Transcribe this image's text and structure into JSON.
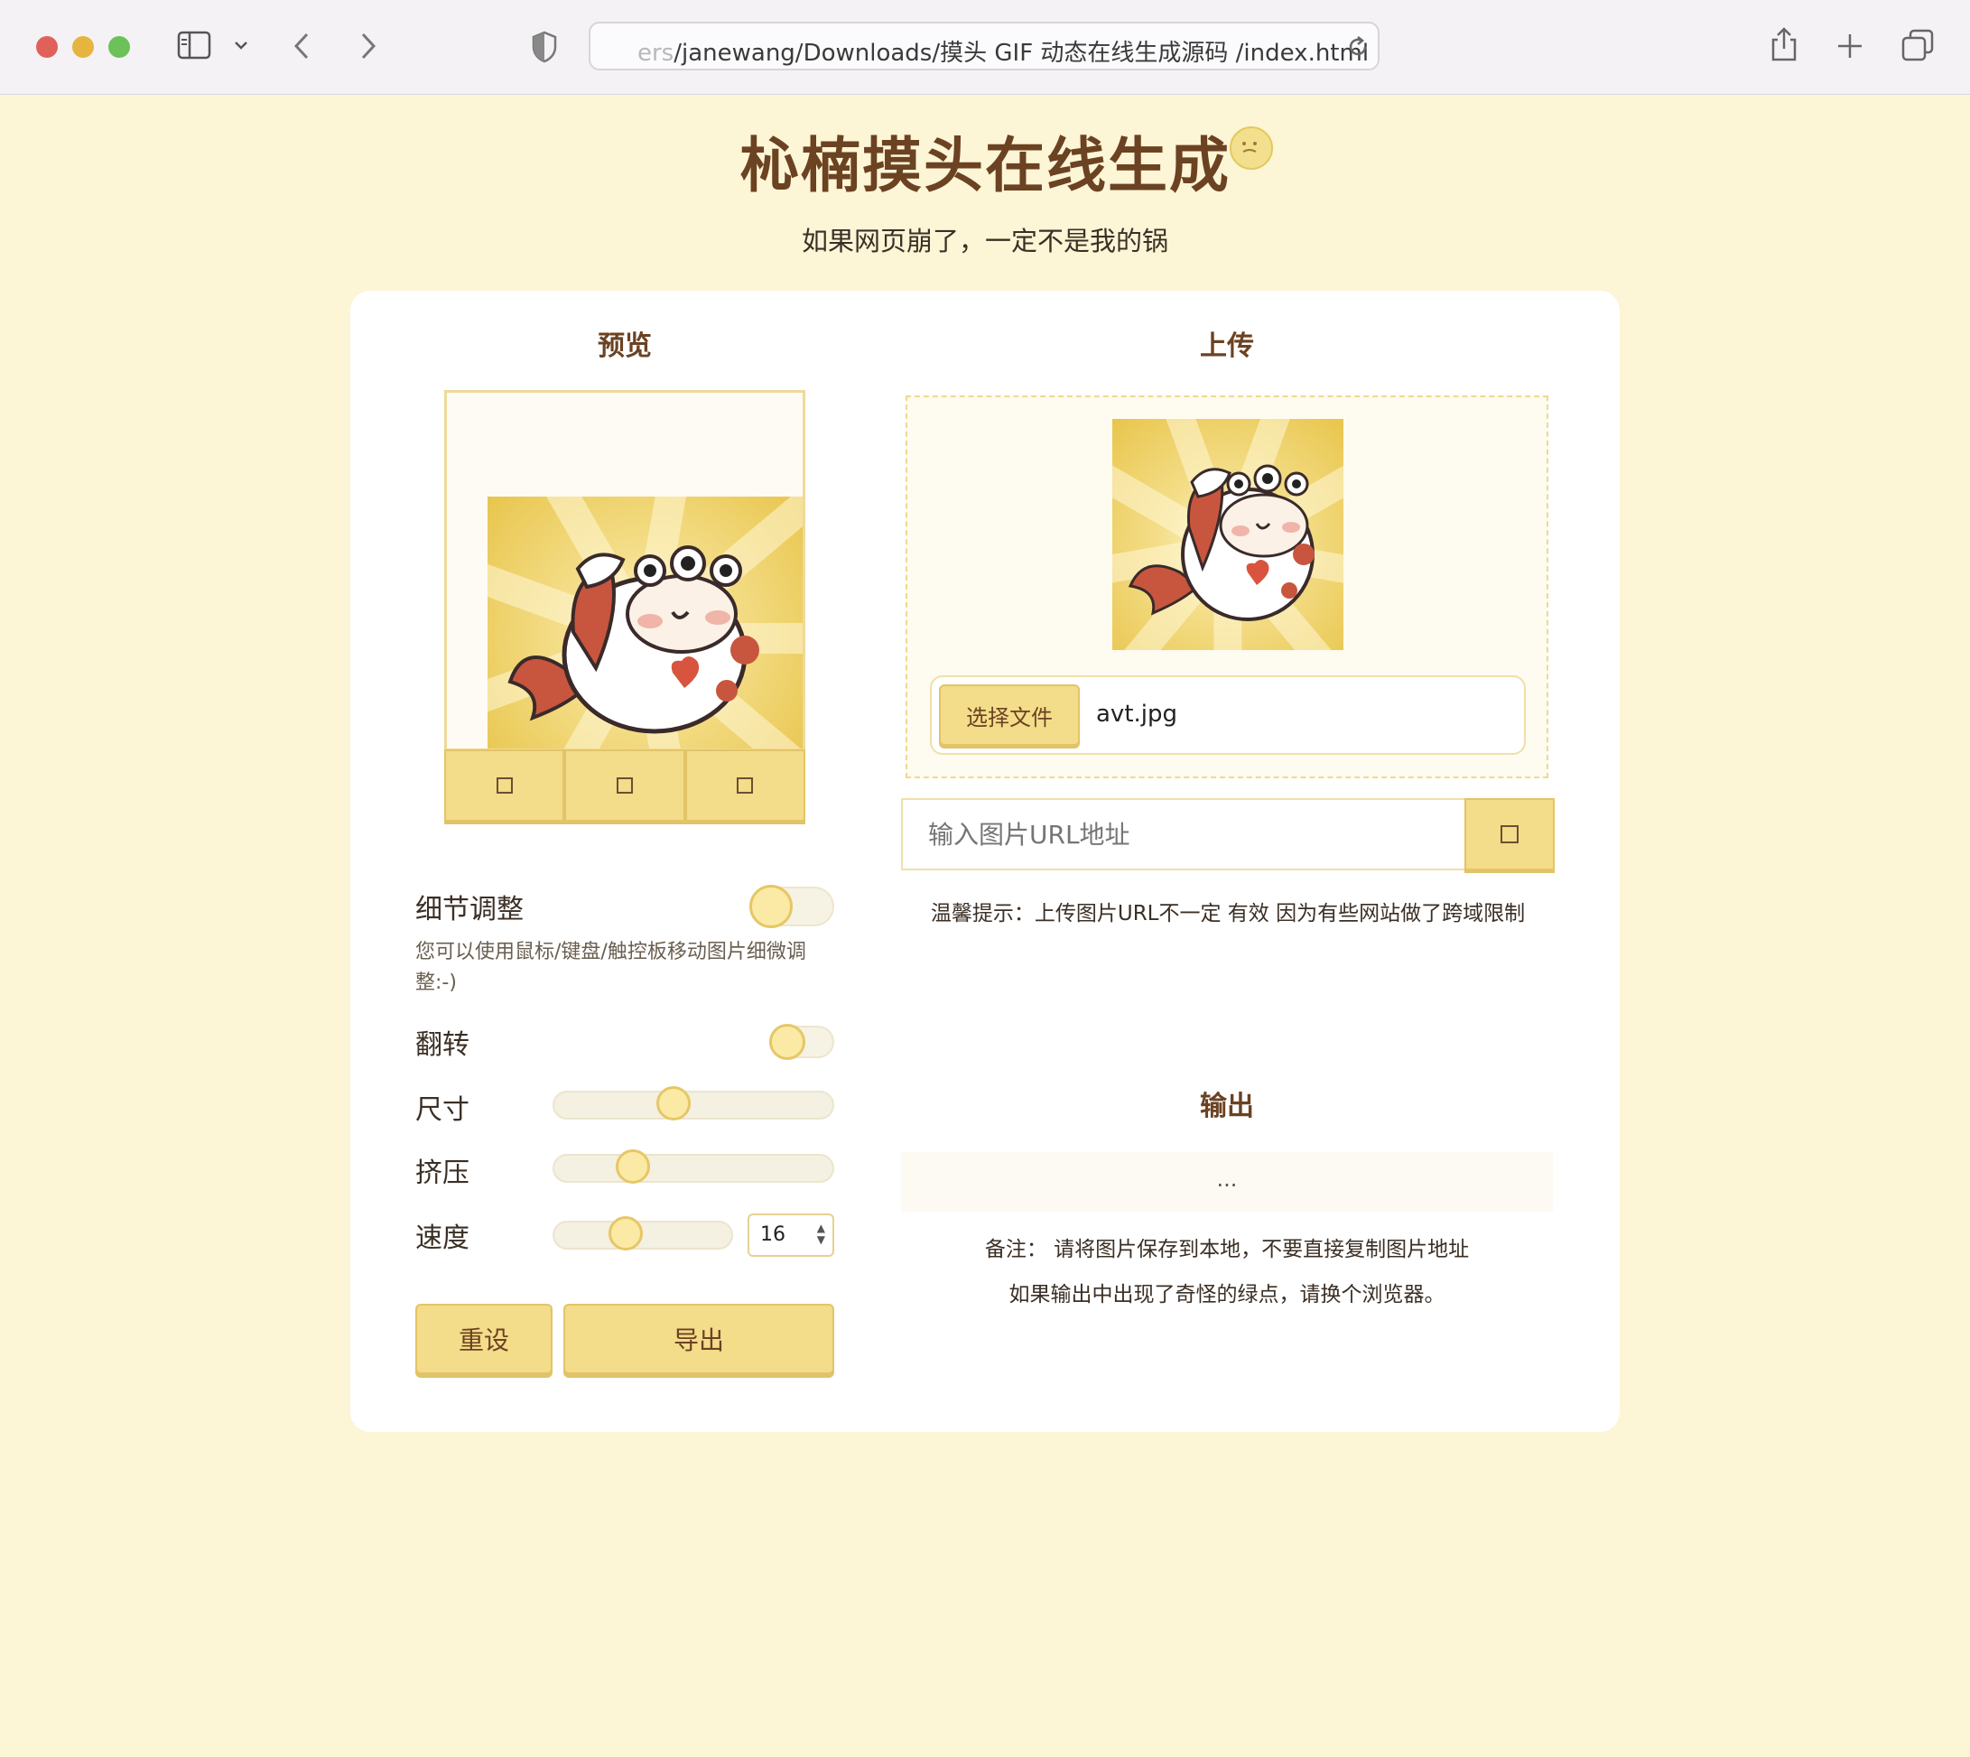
{
  "browser": {
    "url_fade": "ers",
    "url": "/janewang/Downloads/摸头 GIF 动态在线生成源码 /index.html"
  },
  "page": {
    "title": "杺楠摸头在线生成",
    "subtitle": "如果网页崩了，一定不是我的锅"
  },
  "preview": {
    "heading": "预览",
    "buttons": [
      "□",
      "□",
      "□"
    ]
  },
  "controls": {
    "detail_label": "细节调整",
    "detail_hint": "您可以使用鼠标/键盘/触控板移动图片细微调整:-)",
    "flip_label": "翻转",
    "size_label": "尺寸",
    "size_value": 0.42,
    "squeeze_label": "挤压",
    "squeeze_value": 0.25,
    "speed_label": "速度",
    "speed_value": 0.38,
    "speed_number": "16",
    "reset_label": "重设",
    "export_label": "导出"
  },
  "upload": {
    "heading": "上传",
    "file_button": "选择文件",
    "file_name": "avt.jpg",
    "url_placeholder": "输入图片URL地址",
    "tip": "温馨提示：上传图片URL不一定 有效 因为有些网站做了跨域限制"
  },
  "output": {
    "heading": "输出",
    "placeholder": "...",
    "note1": "备注： 请将图片保存到本地，不要直接复制图片地址",
    "note2": "如果输出中出现了奇怪的绿点，请换个浏览器。"
  },
  "colors": {
    "background": "#fcf5d6",
    "accent": "#f3dc8a",
    "title": "#6b4222"
  }
}
